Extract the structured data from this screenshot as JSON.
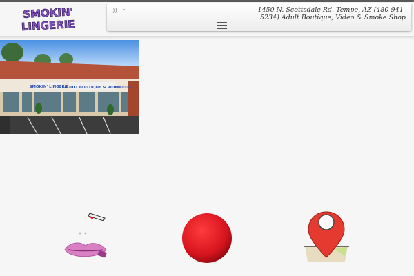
{
  "brand": {
    "logo_text_line1": "SMOKIN'",
    "logo_text_line2": "LINGERIE"
  },
  "header": {
    "social_icons": [
      "rss-icon",
      "facebook-icon"
    ],
    "rss_glyph": "))",
    "facebook_glyph": "f",
    "address": "1450 N. Scottsdale Rd. Tempe, AZ (480-941-5234) Adult Boutique, Video & Smoke Shop",
    "menu_icon": "hamburger-menu-icon"
  },
  "storefront": {
    "sign_text": "SMOKIN' LINGERIE",
    "sign_text2": "ADULT BOUTIQUE & VIDEO",
    "sign_text3": "smoke shop"
  },
  "icons": [
    "lips-lipstick-icon",
    "red-ball-icon",
    "map-pin-icon"
  ],
  "colors": {
    "accent_purple": "#8a56c8",
    "accent_red": "#d6141e",
    "roof": "#b5533a"
  }
}
